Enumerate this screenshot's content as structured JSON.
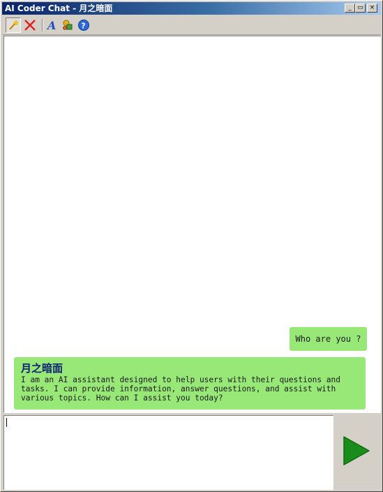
{
  "window": {
    "title": "AI Coder Chat - 月之暗面",
    "controls": {
      "minimize": "_",
      "restore": "▭",
      "maximize": "□",
      "close": "×"
    }
  },
  "toolbar": {
    "items": [
      {
        "name": "new-chat",
        "icon": "wand-icon",
        "pressed": true
      },
      {
        "name": "clear-chat",
        "icon": "red-x-icon",
        "pressed": false
      },
      {
        "name": "font",
        "icon": "font-a-icon",
        "pressed": false
      },
      {
        "name": "settings",
        "icon": "plugin-icon",
        "pressed": false
      },
      {
        "name": "help",
        "icon": "help-icon",
        "pressed": false
      }
    ]
  },
  "chat": {
    "messages": [
      {
        "role": "user",
        "text": "Who are you ?"
      },
      {
        "role": "assistant",
        "name": "月之暗面",
        "text": "I am an AI assistant designed to help users with their questions and\ntasks. I can provide information, answer questions, and assist with\nvarious topics. How can I assist you today?"
      }
    ]
  },
  "input": {
    "value": "",
    "placeholder": ""
  },
  "send": {
    "icon": "send-arrow-icon"
  },
  "colors": {
    "bubble": "#98e878",
    "assistant_name": "#0a1f73",
    "send_arrow": "#1a8c1a",
    "titlebar_start": "#0a246a"
  }
}
